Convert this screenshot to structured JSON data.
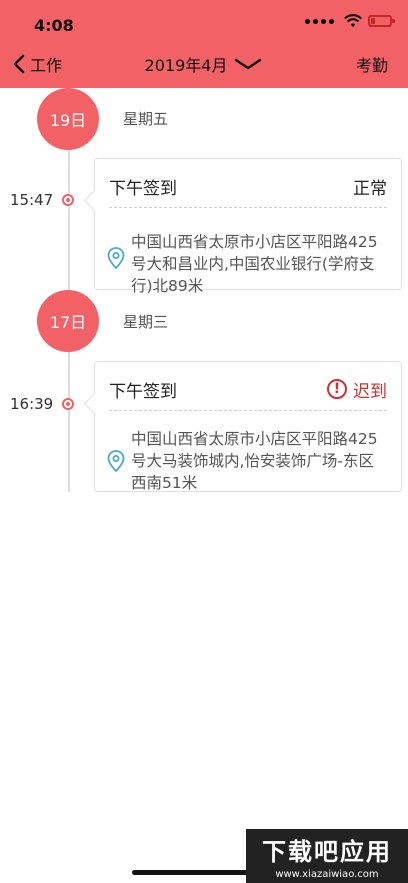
{
  "status_bar": {
    "time": "4:08",
    "battery_color": "#c62828"
  },
  "nav": {
    "back_label": "工作",
    "title": "2019年4月",
    "right_label": "考勤",
    "bar_color": "#f26166"
  },
  "days": [
    {
      "date": "19日",
      "weekday": "星期五",
      "entries": [
        {
          "time": "15:47",
          "title": "下午签到",
          "status": "正常",
          "late": false,
          "address": "中国山西省太原市小店区平阳路425号大和昌业内,中国农业银行(学府支行)北89米"
        }
      ]
    },
    {
      "date": "17日",
      "weekday": "星期三",
      "entries": [
        {
          "time": "16:39",
          "title": "下午签到",
          "status": "迟到",
          "late": true,
          "address": "中国山西省太原市小店区平阳路425号大马装饰城内,怡安装饰广场-东区西南51米"
        }
      ]
    }
  ],
  "watermark": {
    "main": "下载吧应用",
    "url": "www.xiazaiwiao.com"
  }
}
